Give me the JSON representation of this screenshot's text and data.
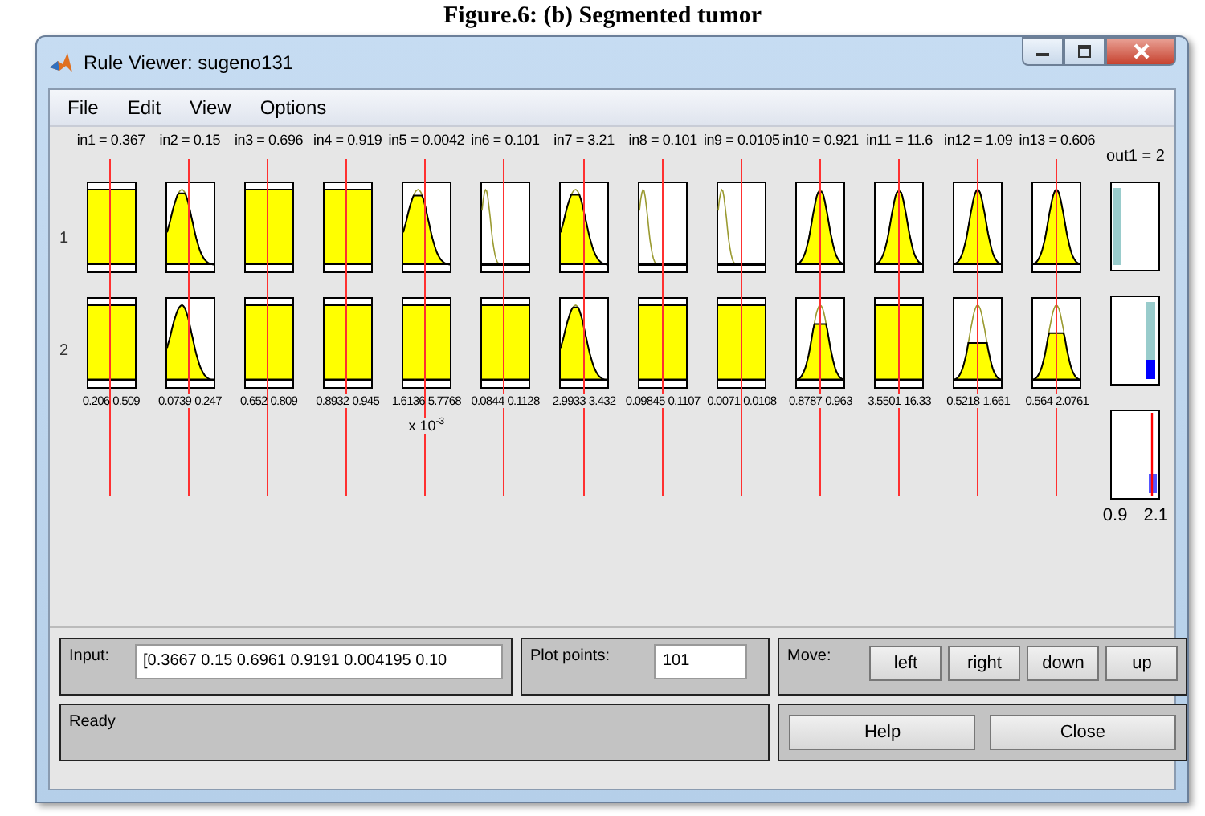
{
  "caption": "Figure.6: (b) Segmented tumor",
  "window": {
    "title": "Rule Viewer: sugeno131"
  },
  "menu": [
    "File",
    "Edit",
    "View",
    "Options"
  ],
  "rule_numbers": [
    "1",
    "2"
  ],
  "inputs": [
    {
      "label": "in1 = 0.367",
      "range": [
        "0.206",
        "0.509"
      ],
      "plots": [
        {
          "kind": "full",
          "level": 1
        },
        {
          "kind": "full",
          "level": 1
        }
      ]
    },
    {
      "label": "in2 = 0.15",
      "range": [
        "0.0739",
        "0.247"
      ],
      "plots": [
        {
          "kind": "skew",
          "level": 0.95
        },
        {
          "kind": "skew",
          "level": 1
        }
      ]
    },
    {
      "label": "in3 = 0.696",
      "range": [
        "0.652",
        "0.809"
      ],
      "plots": [
        {
          "kind": "full",
          "level": 1
        },
        {
          "kind": "full",
          "level": 1
        }
      ]
    },
    {
      "label": "in4 = 0.919",
      "range": [
        "0.8932",
        "0.945"
      ],
      "plots": [
        {
          "kind": "full",
          "level": 1
        },
        {
          "kind": "full",
          "level": 1
        }
      ]
    },
    {
      "label": "in5 = 0.0042",
      "range": [
        "1.6136",
        "5.7768"
      ],
      "scale": "x 10$^{-3}$",
      "plots": [
        {
          "kind": "skew",
          "level": 0.92
        },
        {
          "kind": "full",
          "level": 1
        }
      ]
    },
    {
      "label": "in6 = 0.101",
      "range": [
        "0.0844",
        "0.1128"
      ],
      "plots": [
        {
          "kind": "spike",
          "level": 0
        },
        {
          "kind": "full",
          "level": 1
        }
      ]
    },
    {
      "label": "in7 = 3.21",
      "range": [
        "2.9933",
        "3.432"
      ],
      "plots": [
        {
          "kind": "skew",
          "level": 0.93
        },
        {
          "kind": "skew",
          "level": 0.97
        }
      ]
    },
    {
      "label": "in8 = 0.101",
      "range": [
        "0.09845",
        "0.1107"
      ],
      "plots": [
        {
          "kind": "spike",
          "level": 0
        },
        {
          "kind": "full",
          "level": 1
        }
      ]
    },
    {
      "label": "in9 = 0.0105",
      "range": [
        "0.0071",
        "0.0108"
      ],
      "plots": [
        {
          "kind": "spike",
          "level": 0
        },
        {
          "kind": "full",
          "level": 1
        }
      ]
    },
    {
      "label": "in10 = 0.921",
      "range": [
        "0.8787",
        "0.963"
      ],
      "plots": [
        {
          "kind": "bell",
          "level": 0.97
        },
        {
          "kind": "bell",
          "level": 0.75
        }
      ]
    },
    {
      "label": "in11 = 11.6",
      "range": [
        "3.5501",
        "16.33"
      ],
      "plots": [
        {
          "kind": "bell",
          "level": 0.97
        },
        {
          "kind": "full",
          "level": 1
        }
      ]
    },
    {
      "label": "in12 = 1.09",
      "range": [
        "0.5218",
        "1.661"
      ],
      "plots": [
        {
          "kind": "bell",
          "level": 1
        },
        {
          "kind": "bell",
          "level": 0.5
        }
      ]
    },
    {
      "label": "in13 = 0.606",
      "range": [
        "0.564",
        "2.0761"
      ],
      "plots": [
        {
          "kind": "bell",
          "level": 1
        },
        {
          "kind": "bell",
          "level": 0.63
        }
      ]
    }
  ],
  "output": {
    "label": "out1 = 2",
    "range": [
      "0.9",
      "2.1"
    ]
  },
  "input_panel": {
    "label": "Input:",
    "value": "[0.3667 0.15 0.6961 0.9191 0.004195 0.10"
  },
  "plot_points": {
    "label": "Plot points:",
    "value": "101"
  },
  "move": {
    "label": "Move:",
    "buttons": [
      "left",
      "right",
      "down",
      "up"
    ]
  },
  "status": "Ready",
  "buttons": [
    "Help",
    "Close"
  ]
}
